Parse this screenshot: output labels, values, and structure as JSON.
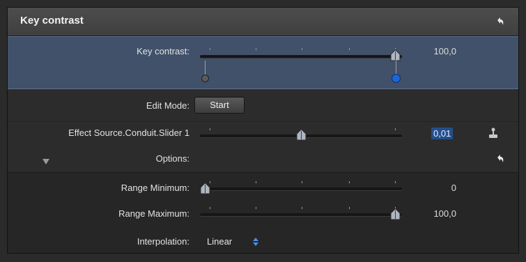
{
  "header": {
    "title": "Key contrast",
    "reset_icon": "undo-arrow-icon"
  },
  "key_contrast": {
    "label": "Key contrast:",
    "value": "100,0",
    "knob_fraction": 1.0,
    "keyframe_start_color": "#5a5a5a",
    "keyframe_end_color": "#1e63d8"
  },
  "edit_mode": {
    "label": "Edit Mode:",
    "button": "Start"
  },
  "effect_source": {
    "label": "Effect Source.Conduit.Slider 1",
    "value": "0,01",
    "knob_fraction": 0.5,
    "side_icon": "puppet-joystick-icon"
  },
  "options": {
    "label": "Options:",
    "disclosure_icon": "triangle-down-icon",
    "reset_icon": "undo-arrow-icon"
  },
  "range_minimum": {
    "label": "Range Minimum:",
    "value": "0",
    "knob_fraction": 0.0
  },
  "range_maximum": {
    "label": "Range Maximum:",
    "value": "100,0",
    "knob_fraction": 1.0
  },
  "interpolation": {
    "label": "Interpolation:",
    "selected": "Linear",
    "chevron_icon": "updown-chevron-icon"
  },
  "colors": {
    "selection_row": "#41516a",
    "selection_border": "#607392",
    "value_highlight": "#244e8a"
  }
}
